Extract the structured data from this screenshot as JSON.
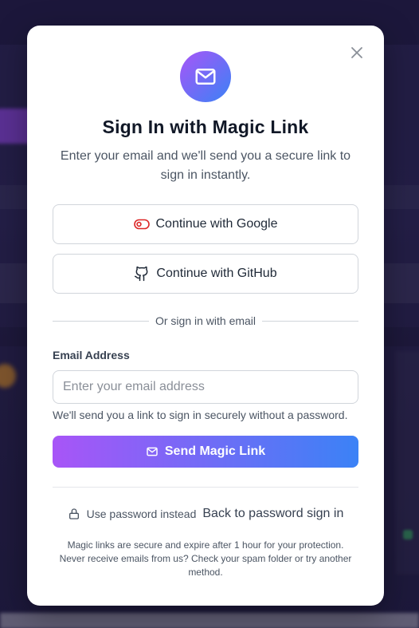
{
  "modal": {
    "title": "Sign In with Magic Link",
    "subtitle": "Enter your email and we'll send you a secure link to sign in instantly.",
    "close_icon": "close-icon",
    "hero_icon": "mail-icon"
  },
  "oauth": {
    "google_label": "Continue with Google",
    "google_icon": "toggle-icon",
    "github_label": "Continue with GitHub",
    "github_icon": "github-icon"
  },
  "divider_text": "Or sign in with email",
  "email": {
    "label": "Email Address",
    "placeholder": "Enter your email address",
    "value": "",
    "hint": "We'll send you a link to sign in securely without a password."
  },
  "send_button": {
    "label": "Send Magic Link",
    "icon": "mail-icon"
  },
  "alt_links": {
    "password_label": "Use password instead",
    "password_icon": "lock-icon",
    "back_label": "Back to password sign in"
  },
  "footer": {
    "line1": "Magic links are secure and expire after 1 hour for your protection.",
    "line2": "Never receive emails from us? Check your spam folder or try another method."
  },
  "colors": {
    "accent_start": "#a855f7",
    "accent_end": "#3b82f6",
    "google_red": "#dc2626"
  }
}
